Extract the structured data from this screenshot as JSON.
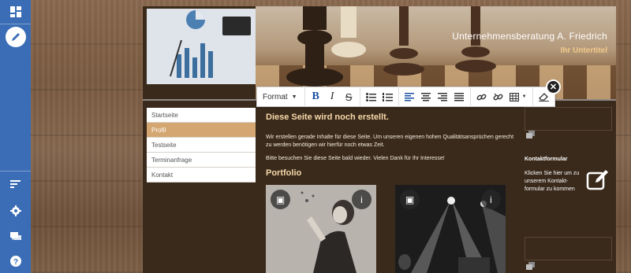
{
  "rail": {
    "top_icons": [
      "dashboard-icon",
      "edit-icon"
    ],
    "bottom_icons": [
      "sort-icon",
      "settings-icon",
      "chat-icon",
      "help-icon"
    ]
  },
  "site": {
    "title": "Unternehmensberatung A. Friedrich",
    "subtitle": "Ihr Untertitel"
  },
  "nav": {
    "items": [
      {
        "label": "Startseite"
      },
      {
        "label": "Profil"
      },
      {
        "label": "Testseite"
      },
      {
        "label": "Terminanfrage"
      },
      {
        "label": "Kontakt"
      }
    ],
    "active_index": 1
  },
  "content": {
    "heading": "Diese Seite wird noch erstellt.",
    "para1": "Wir erstellen gerade Inhalte für diese Seite. Um unseren eigenen hohen Qualitätsansprüchen gerecht zu werden benötigen wir hierfür noch etwas Zeit.",
    "para2": "Bitte besuchen Sie diese Seite bald wieder. Vielen Dank für Ihr Interesse!",
    "portfolio_heading": "Portfolio"
  },
  "sidebar": {
    "contact_title": "Kontaktformular",
    "contact_text": "Klicken Sie hier um zu unserem Kontakt-formular zu kommen"
  },
  "toolbar": {
    "format_label": "Format",
    "bold": "B",
    "italic": "I",
    "strike": "S"
  },
  "colors": {
    "rail": "#3a6db5",
    "active_nav": "#d4a772",
    "heading": "#f6d9a9",
    "site_bg": "#3a2a1b"
  }
}
